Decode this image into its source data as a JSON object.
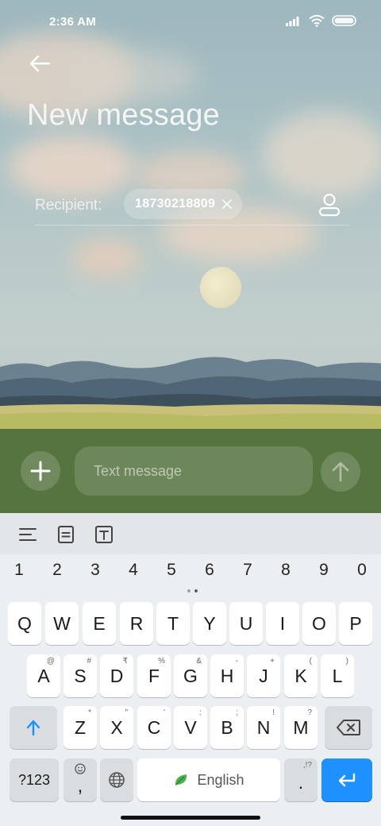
{
  "status": {
    "time": "2:36 AM"
  },
  "header": {
    "title": "New message"
  },
  "recipient": {
    "label": "Recipient:",
    "chip": "18730218809"
  },
  "compose": {
    "placeholder": "Text message"
  },
  "keyboard": {
    "numbers": [
      "1",
      "2",
      "3",
      "4",
      "5",
      "6",
      "7",
      "8",
      "9",
      "0"
    ],
    "row1": [
      "Q",
      "W",
      "E",
      "R",
      "T",
      "Y",
      "U",
      "I",
      "O",
      "P"
    ],
    "row2": [
      {
        "key": "A",
        "sub": "@"
      },
      {
        "key": "S",
        "sub": "#"
      },
      {
        "key": "D",
        "sub": "₹"
      },
      {
        "key": "F",
        "sub": "%"
      },
      {
        "key": "G",
        "sub": "&"
      },
      {
        "key": "H",
        "sub": "-"
      },
      {
        "key": "J",
        "sub": "+"
      },
      {
        "key": "K",
        "sub": "("
      },
      {
        "key": "L",
        "sub": ")"
      }
    ],
    "row3": [
      {
        "key": "Z",
        "sub": "*"
      },
      {
        "key": "X",
        "sub": "\""
      },
      {
        "key": "C",
        "sub": "'"
      },
      {
        "key": "V",
        "sub": ":"
      },
      {
        "key": "B",
        "sub": ";"
      },
      {
        "key": "N",
        "sub": "!"
      },
      {
        "key": "M",
        "sub": "?"
      }
    ],
    "symbols_label": "?123",
    "comma": ",",
    "period": ".",
    "period_sub": ",!?",
    "space_label": "English"
  },
  "colors": {
    "compose_bg": "#56743f",
    "enter_key": "#1e90ff",
    "keyboard_bg": "#eceff1"
  }
}
